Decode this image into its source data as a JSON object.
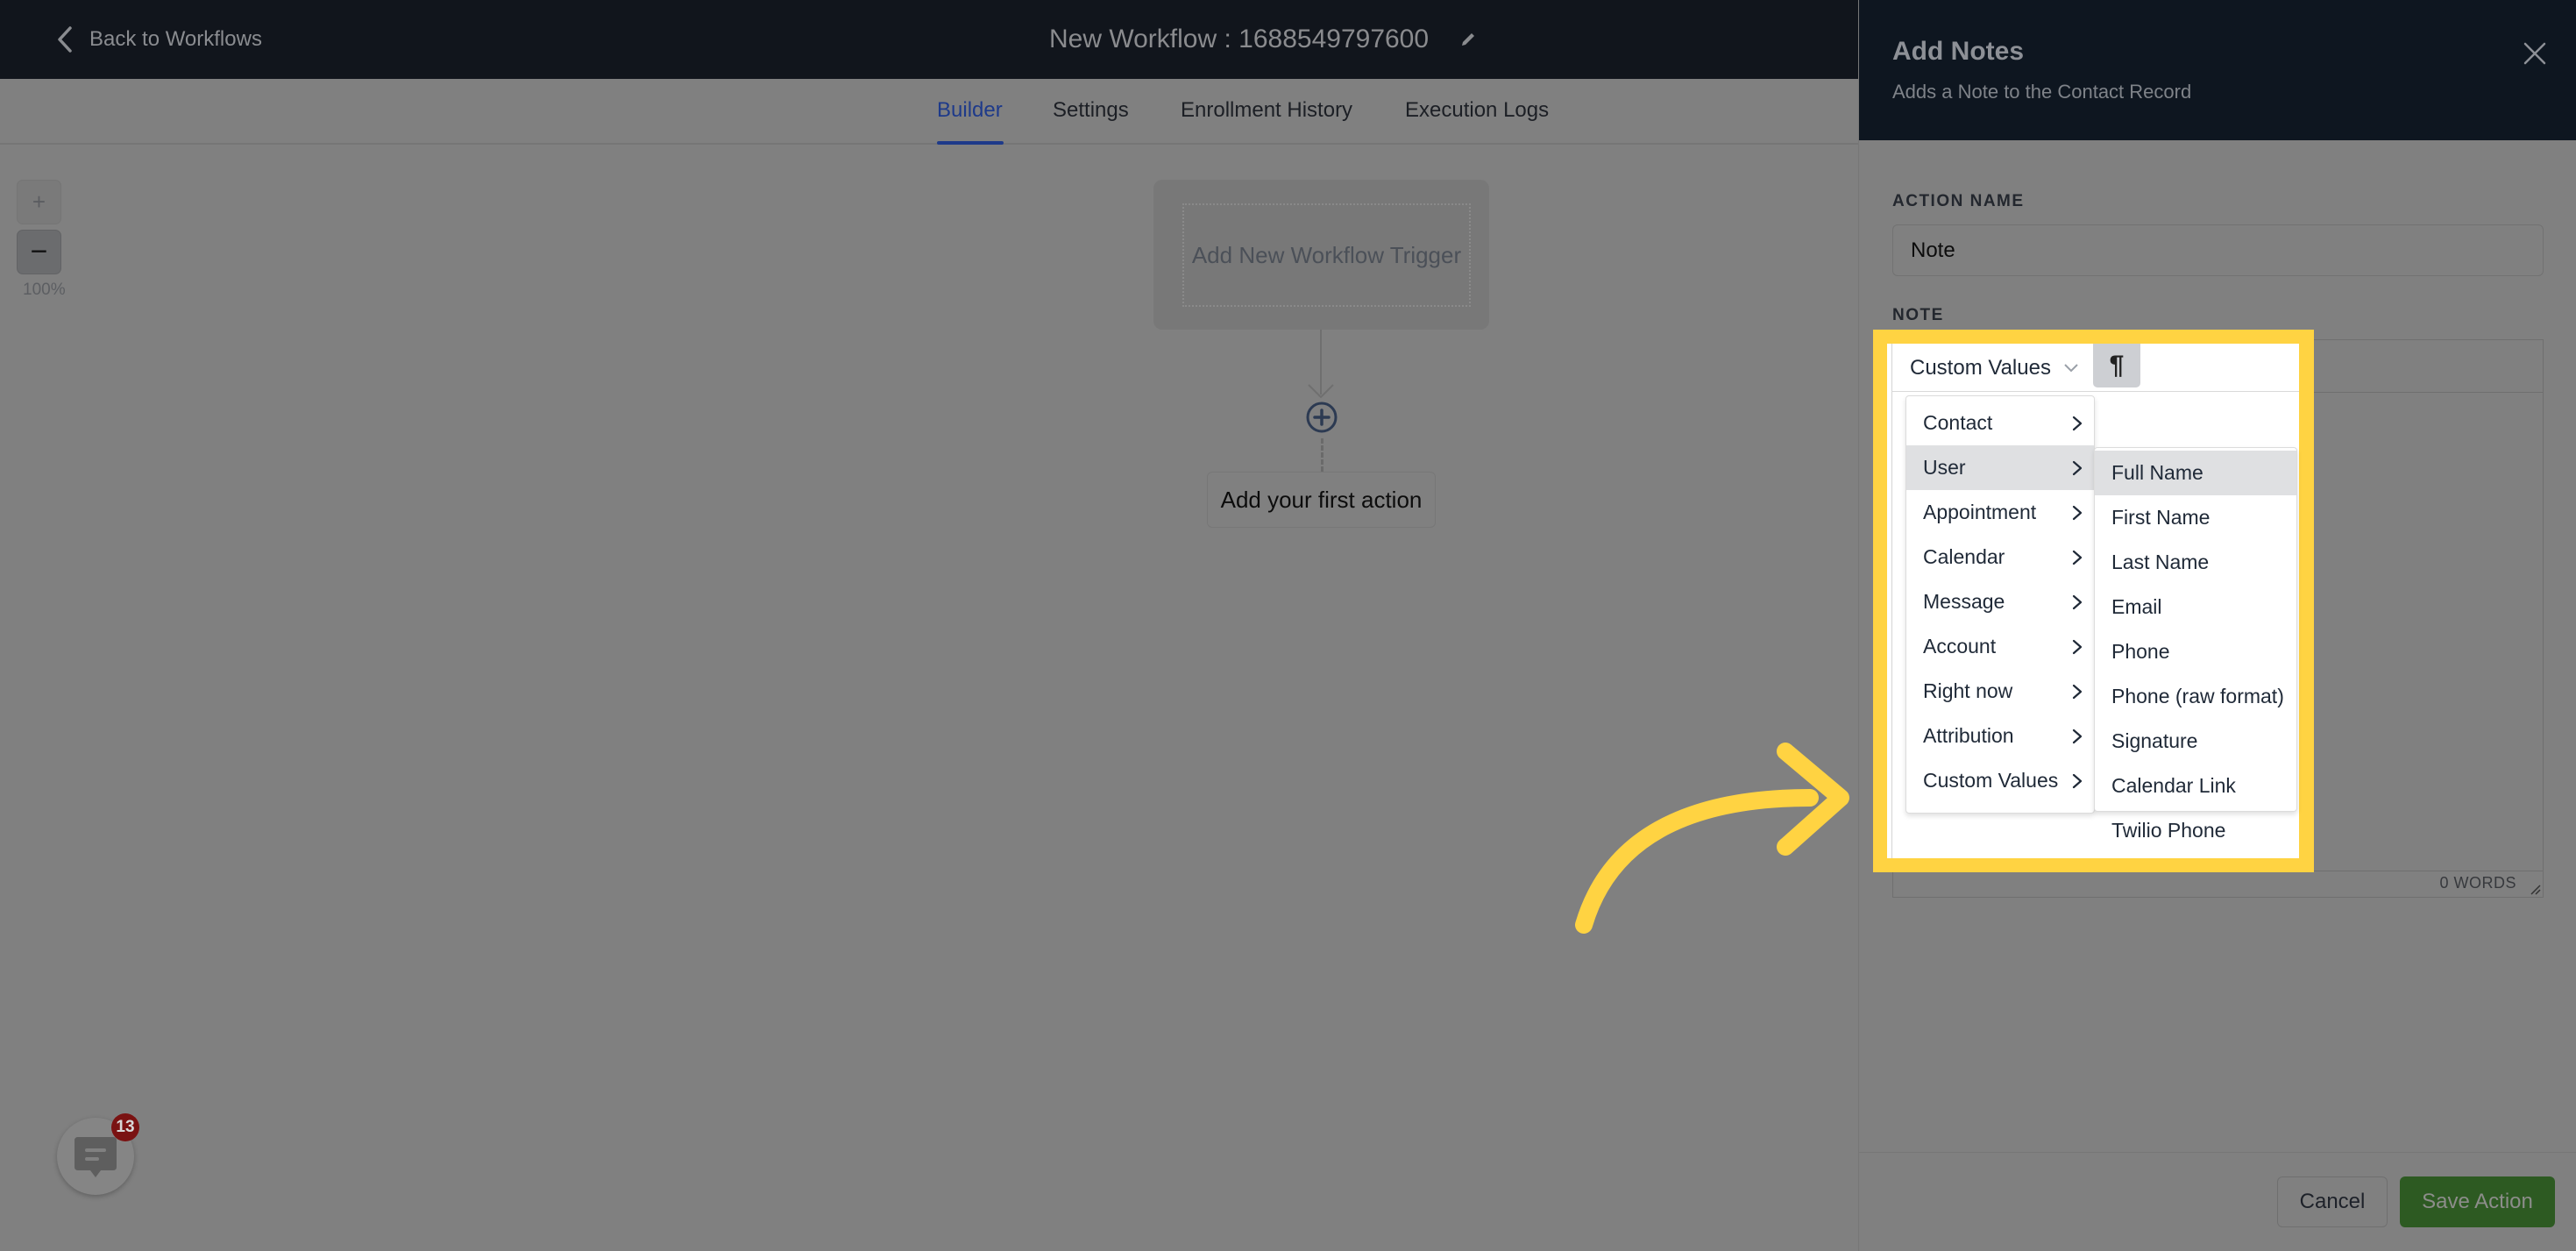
{
  "header": {
    "back_label": "Back to Workflows",
    "workflow_title": "New Workflow : 1688549797600"
  },
  "tabs": [
    {
      "label": "Builder",
      "active": true
    },
    {
      "label": "Settings",
      "active": false
    },
    {
      "label": "Enrollment History",
      "active": false
    },
    {
      "label": "Execution Logs",
      "active": false
    }
  ],
  "canvas": {
    "zoom_in_label": "+",
    "zoom_out_label": "−",
    "zoom_level": "100%",
    "trigger_label": "Add New Workflow Trigger",
    "first_action_label": "Add your first action"
  },
  "chat": {
    "badge_count": "13"
  },
  "panel": {
    "title": "Add Notes",
    "subtitle": "Adds a Note to the Contact Record",
    "action_name_label": "ACTION NAME",
    "action_name_value": "Note",
    "note_label": "NOTE",
    "custom_values_label": "Custom Values",
    "paragraph_symbol": "¶",
    "word_count": "0 WORDS",
    "cancel_label": "Cancel",
    "save_label": "Save Action"
  },
  "menu": {
    "categories": [
      {
        "label": "Contact",
        "hovered": false
      },
      {
        "label": "User",
        "hovered": true
      },
      {
        "label": "Appointment",
        "hovered": false
      },
      {
        "label": "Calendar",
        "hovered": false
      },
      {
        "label": "Message",
        "hovered": false
      },
      {
        "label": "Account",
        "hovered": false
      },
      {
        "label": "Right now",
        "hovered": false
      },
      {
        "label": "Attribution",
        "hovered": false
      },
      {
        "label": "Custom Values",
        "hovered": false
      }
    ],
    "user_submenu": [
      {
        "label": "Full Name",
        "hovered": true
      },
      {
        "label": "First Name",
        "hovered": false
      },
      {
        "label": "Last Name",
        "hovered": false
      },
      {
        "label": "Email",
        "hovered": false
      },
      {
        "label": "Phone",
        "hovered": false
      },
      {
        "label": "Phone (raw format)",
        "hovered": false
      },
      {
        "label": "Signature",
        "hovered": false
      },
      {
        "label": "Calendar Link",
        "hovered": false
      },
      {
        "label": "Twilio Phone",
        "hovered": false
      }
    ]
  },
  "colors": {
    "highlight": "#ffd342",
    "active_tab": "#1e3a8a",
    "save_button": "#2d5a22",
    "badge": "#7a1212",
    "header_bg": "#11151c"
  }
}
